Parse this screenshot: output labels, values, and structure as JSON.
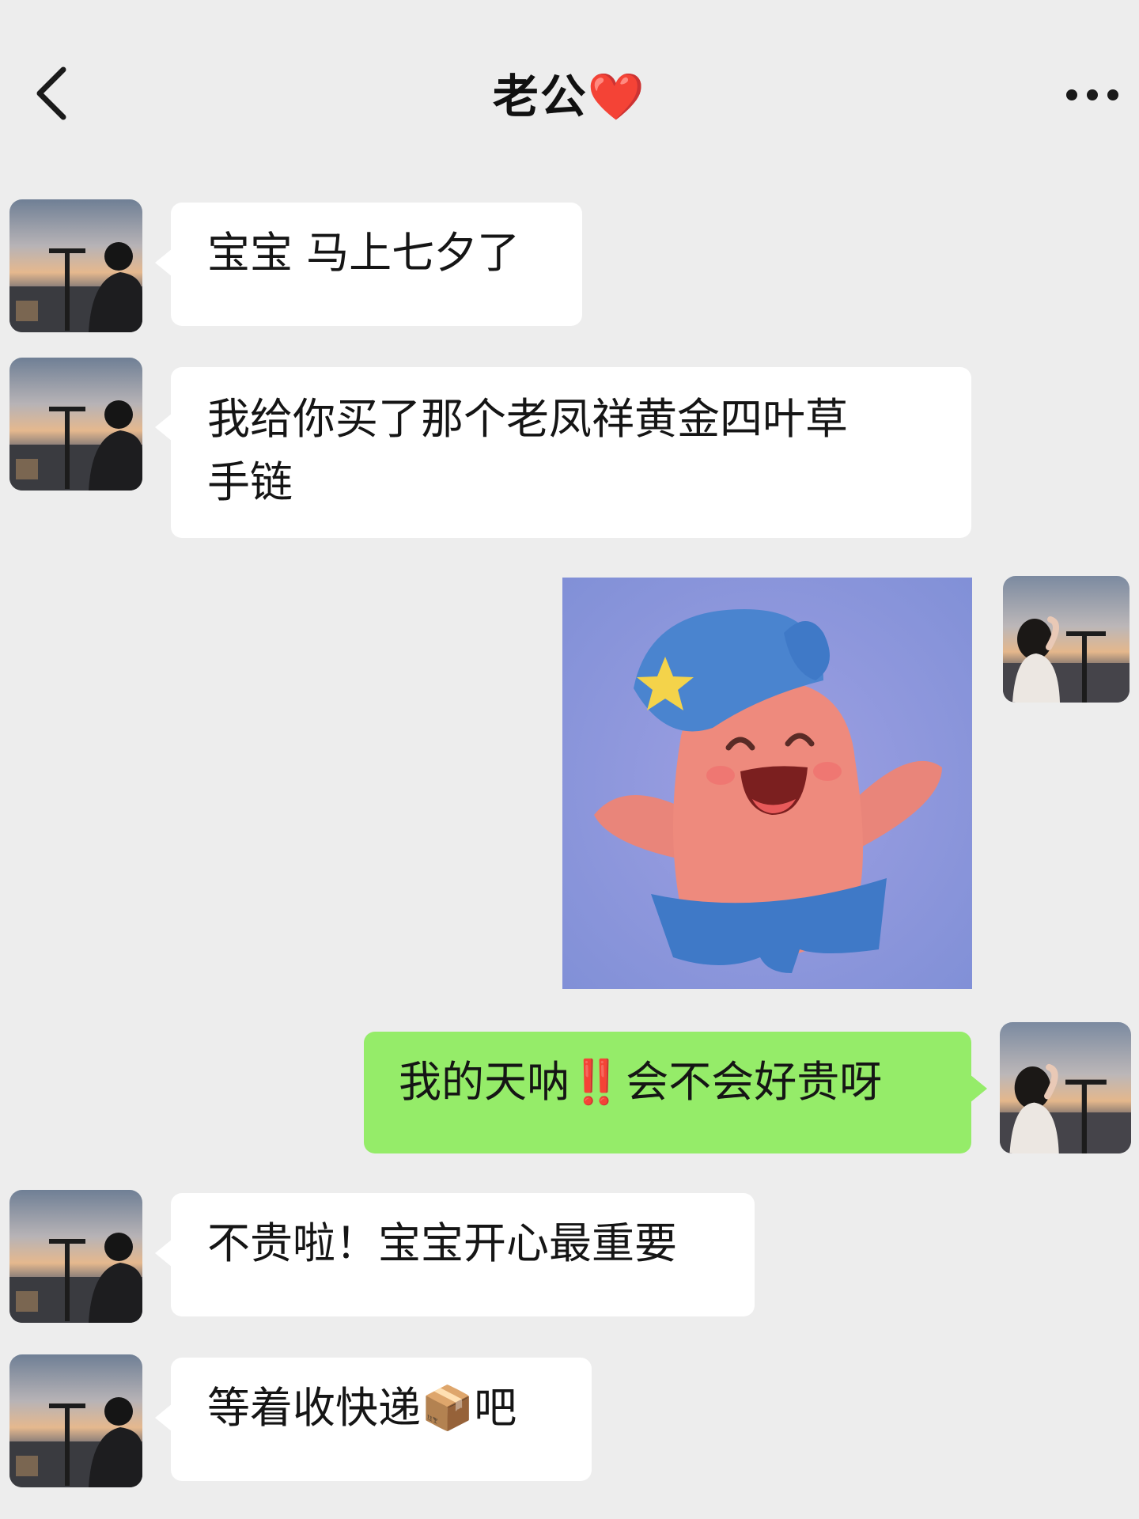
{
  "header": {
    "title": "老公",
    "title_emoji": "❤️",
    "back_icon": "chevron-left-icon",
    "more_icon": "more-dots-icon"
  },
  "messages": [
    {
      "sender": "contact",
      "type": "text",
      "text": "宝宝 马上七夕了"
    },
    {
      "sender": "contact",
      "type": "text",
      "lines": [
        "我给你买了那个老凤祥黄金四叶草",
        "手链"
      ]
    },
    {
      "sender": "me",
      "type": "sticker",
      "sticker": "smiling-pink-star-character-with-blue-hat"
    },
    {
      "sender": "me",
      "type": "text",
      "text_before": "我的天呐",
      "emoji": "‼️",
      "text_after": "会不会好贵呀"
    },
    {
      "sender": "contact",
      "type": "text",
      "text": "不贵啦！宝宝开心最重要"
    },
    {
      "sender": "contact",
      "type": "text",
      "text_before": "等着收快递",
      "emoji": "📦",
      "text_after": "吧"
    }
  ],
  "colors": {
    "background": "#ededed",
    "incoming_bubble": "#ffffff",
    "outgoing_bubble": "#95ec69",
    "heart": "#e0262e"
  }
}
